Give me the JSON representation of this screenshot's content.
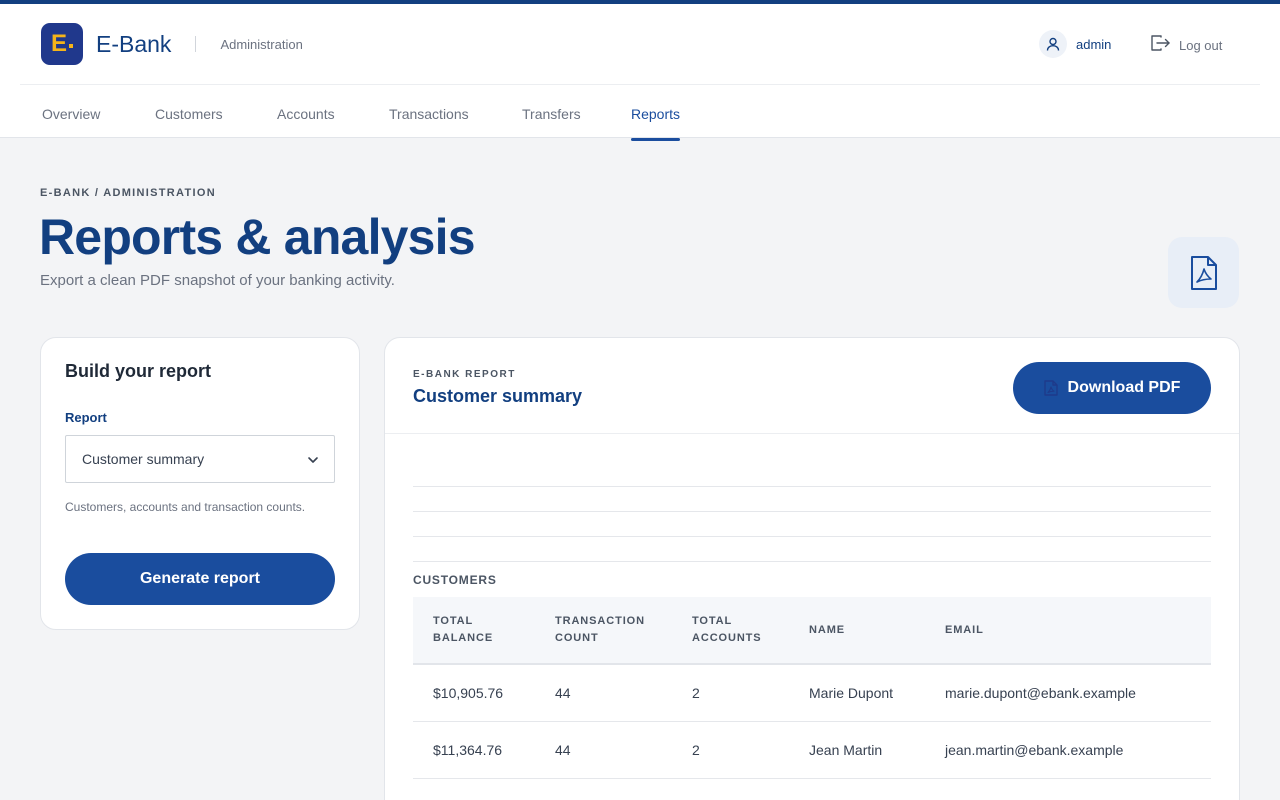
{
  "brand": {
    "logo_letter": "E",
    "name": "E-Bank",
    "section": "Administration"
  },
  "user": {
    "name": "admin",
    "logout_label": "Log out"
  },
  "nav": {
    "items": [
      {
        "label": "Overview"
      },
      {
        "label": "Customers"
      },
      {
        "label": "Accounts"
      },
      {
        "label": "Transactions"
      },
      {
        "label": "Transfers"
      },
      {
        "label": "Reports"
      }
    ],
    "active": "Reports"
  },
  "page": {
    "breadcrumb": "E-BANK / ADMINISTRATION",
    "title": "Reports & analysis",
    "subtitle": "Export a clean PDF snapshot of your banking activity."
  },
  "builder": {
    "title": "Build your report",
    "report_label": "Report",
    "selected_report": "Customer summary",
    "description": "Customers, accounts and transaction counts.",
    "generate_label": "Generate report"
  },
  "preview": {
    "kicker": "E-BANK REPORT",
    "title": "Customer summary",
    "download_label": "Download PDF",
    "section_label": "CUSTOMERS",
    "columns": [
      "TOTAL BALANCE",
      "TRANSACTION COUNT",
      "TOTAL ACCOUNTS",
      "NAME",
      "EMAIL"
    ],
    "rows": [
      [
        "$10,905.76",
        "44",
        "2",
        "Marie Dupont",
        "marie.dupont@ebank.example"
      ],
      [
        "$11,364.76",
        "44",
        "2",
        "Jean Martin",
        "jean.martin@ebank.example"
      ]
    ]
  },
  "colors": {
    "primary": "#123f80",
    "button": "#1a4d9e",
    "logo_bg": "#20388c",
    "logo_fg": "#f5b41a",
    "page_bg": "#f3f4f6"
  }
}
